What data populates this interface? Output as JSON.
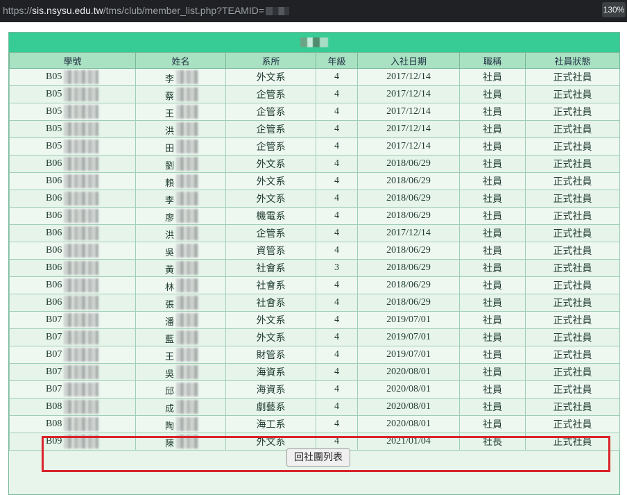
{
  "browser": {
    "url_prefix": "https://",
    "url_host": "sis.nsysu.edu.tw",
    "url_path": "/tms/club/member_list.php?TEAMID=",
    "zoom": "130%"
  },
  "table": {
    "headers": [
      "學號",
      "姓名",
      "系所",
      "年級",
      "入社日期",
      "職稱",
      "社員狀態"
    ],
    "rows": [
      {
        "id": "B05",
        "name": "李",
        "dept": "外文系",
        "grade": "4",
        "date": "2017/12/14",
        "title": "社員",
        "status": "正式社員"
      },
      {
        "id": "B05",
        "name": "蔡",
        "dept": "企管系",
        "grade": "4",
        "date": "2017/12/14",
        "title": "社員",
        "status": "正式社員"
      },
      {
        "id": "B05",
        "name": "王",
        "dept": "企管系",
        "grade": "4",
        "date": "2017/12/14",
        "title": "社員",
        "status": "正式社員"
      },
      {
        "id": "B05",
        "name": "洪",
        "dept": "企管系",
        "grade": "4",
        "date": "2017/12/14",
        "title": "社員",
        "status": "正式社員"
      },
      {
        "id": "B05",
        "name": "田",
        "dept": "企管系",
        "grade": "4",
        "date": "2017/12/14",
        "title": "社員",
        "status": "正式社員"
      },
      {
        "id": "B06",
        "name": "劉",
        "dept": "外文系",
        "grade": "4",
        "date": "2018/06/29",
        "title": "社員",
        "status": "正式社員"
      },
      {
        "id": "B06",
        "name": "賴",
        "dept": "外文系",
        "grade": "4",
        "date": "2018/06/29",
        "title": "社員",
        "status": "正式社員"
      },
      {
        "id": "B06",
        "name": "李",
        "dept": "外文系",
        "grade": "4",
        "date": "2018/06/29",
        "title": "社員",
        "status": "正式社員"
      },
      {
        "id": "B06",
        "name": "廖",
        "dept": "機電系",
        "grade": "4",
        "date": "2018/06/29",
        "title": "社員",
        "status": "正式社員"
      },
      {
        "id": "B06",
        "name": "洪",
        "dept": "企管系",
        "grade": "4",
        "date": "2017/12/14",
        "title": "社員",
        "status": "正式社員"
      },
      {
        "id": "B06",
        "name": "吳",
        "dept": "資管系",
        "grade": "4",
        "date": "2018/06/29",
        "title": "社員",
        "status": "正式社員"
      },
      {
        "id": "B06",
        "name": "黃",
        "dept": "社會系",
        "grade": "3",
        "date": "2018/06/29",
        "title": "社員",
        "status": "正式社員"
      },
      {
        "id": "B06",
        "name": "林",
        "dept": "社會系",
        "grade": "4",
        "date": "2018/06/29",
        "title": "社員",
        "status": "正式社員"
      },
      {
        "id": "B06",
        "name": "張",
        "dept": "社會系",
        "grade": "4",
        "date": "2018/06/29",
        "title": "社員",
        "status": "正式社員"
      },
      {
        "id": "B07",
        "name": "潘",
        "dept": "外文系",
        "grade": "4",
        "date": "2019/07/01",
        "title": "社員",
        "status": "正式社員"
      },
      {
        "id": "B07",
        "name": "藍",
        "dept": "外文系",
        "grade": "4",
        "date": "2019/07/01",
        "title": "社員",
        "status": "正式社員"
      },
      {
        "id": "B07",
        "name": "王",
        "dept": "財管系",
        "grade": "4",
        "date": "2019/07/01",
        "title": "社員",
        "status": "正式社員"
      },
      {
        "id": "B07",
        "name": "吳",
        "dept": "海資系",
        "grade": "4",
        "date": "2020/08/01",
        "title": "社員",
        "status": "正式社員"
      },
      {
        "id": "B07",
        "name": "邱",
        "dept": "海資系",
        "grade": "4",
        "date": "2020/08/01",
        "title": "社員",
        "status": "正式社員"
      },
      {
        "id": "B08",
        "name": "成",
        "dept": "劇藝系",
        "grade": "4",
        "date": "2020/08/01",
        "title": "社員",
        "status": "正式社員"
      },
      {
        "id": "B08",
        "name": "陶",
        "dept": "海工系",
        "grade": "4",
        "date": "2020/08/01",
        "title": "社員",
        "status": "正式社員"
      },
      {
        "id": "B09",
        "name": "陳",
        "dept": "外文系",
        "grade": "4",
        "date": "2021/01/04",
        "title": "社長",
        "status": "正式社員"
      }
    ]
  },
  "footer": {
    "back_label": "回社團列表"
  },
  "colors": {
    "title_bar": "#37cc95",
    "header_bg": "#a9e1c3",
    "highlight": "#d9242a"
  }
}
